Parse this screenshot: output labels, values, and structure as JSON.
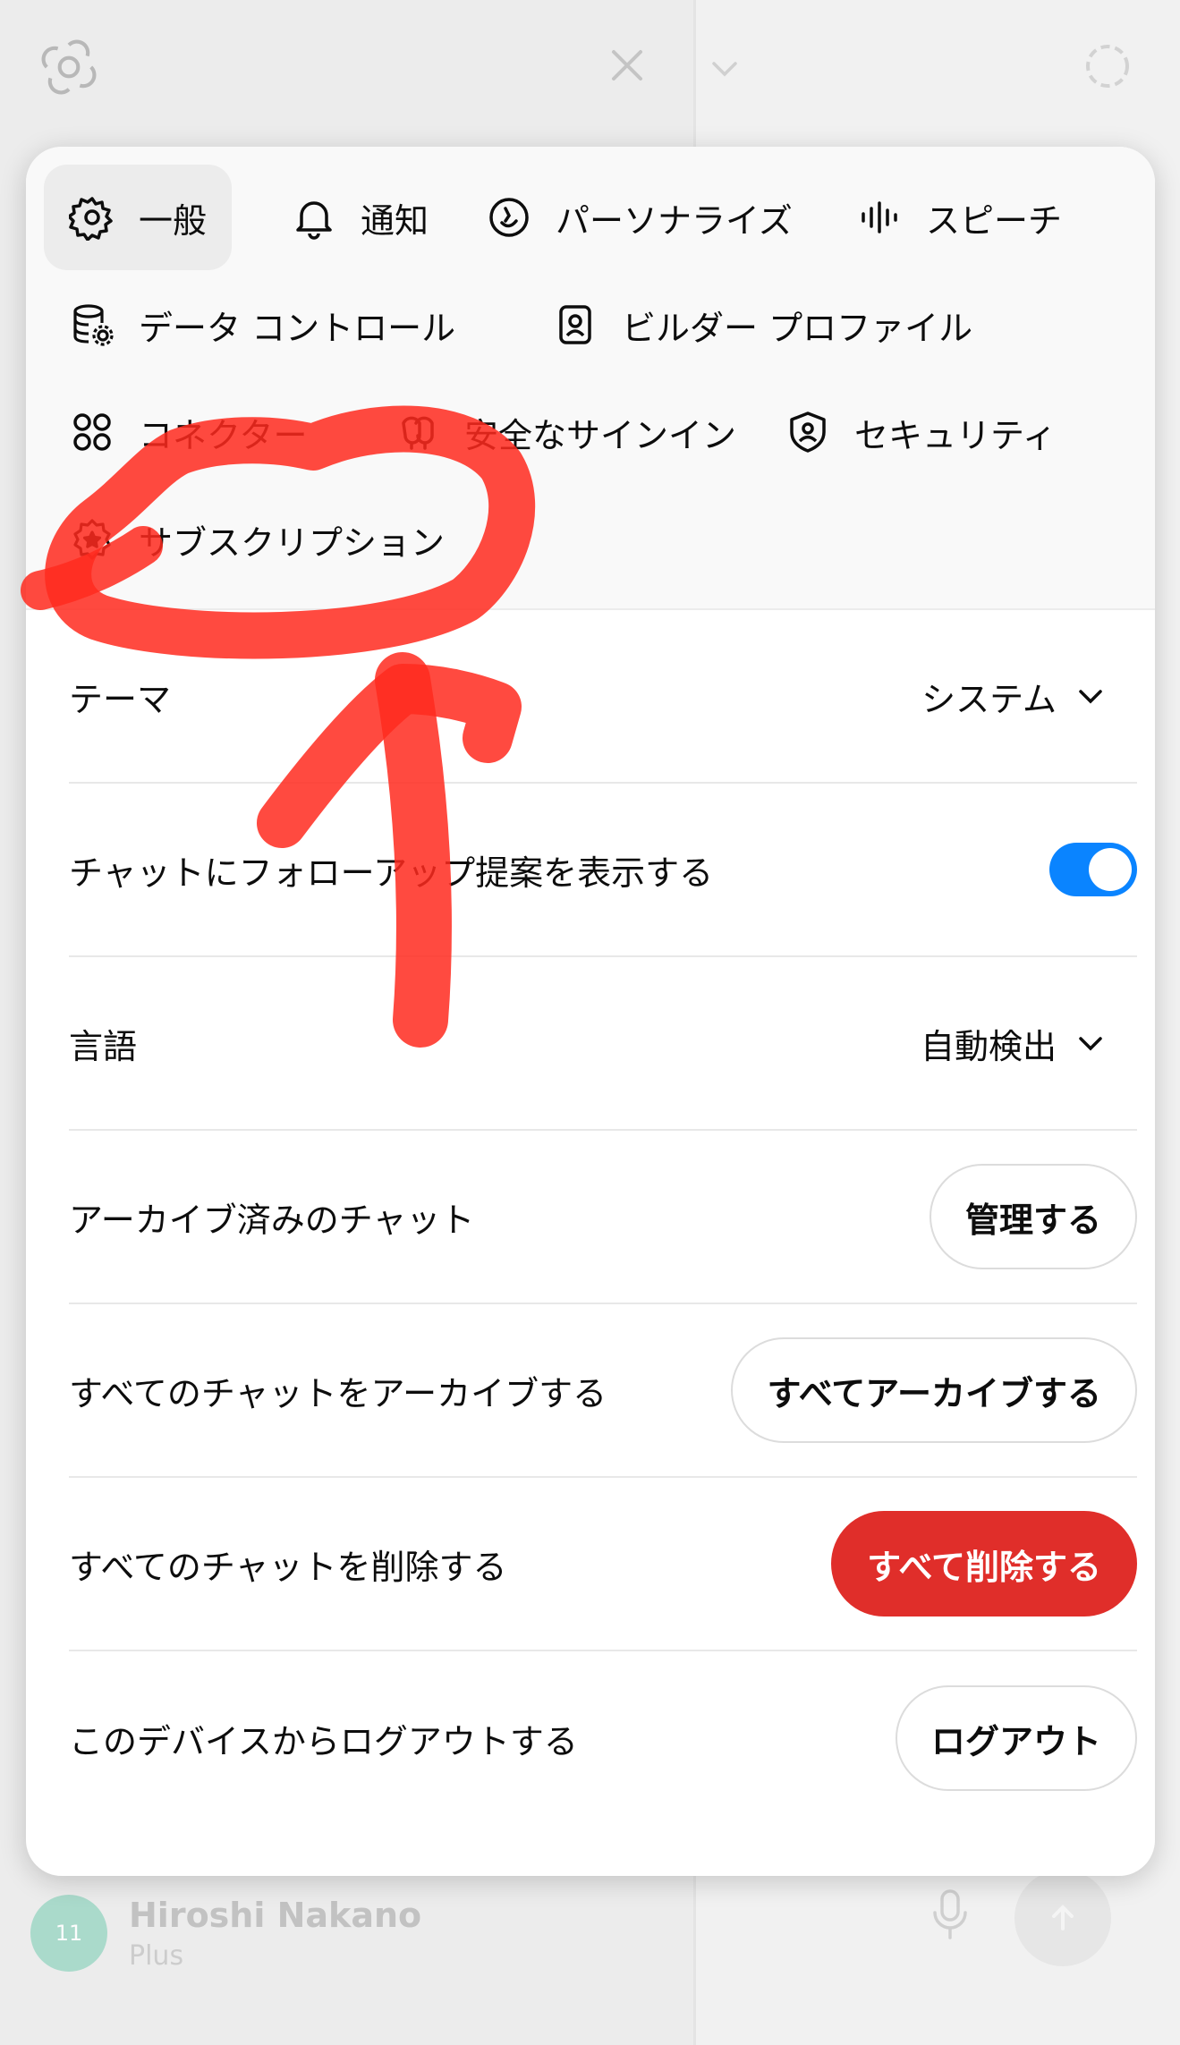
{
  "background": {
    "user_name": "Hiroshi Nakano",
    "user_plan": "Plus",
    "avatar_text": "11",
    "icons": [
      "openai-logo-icon",
      "close-icon",
      "chevron-down-icon",
      "new-chat-icon",
      "microphone-icon",
      "send-icon"
    ]
  },
  "tabs": [
    {
      "label": "一般",
      "icon": "gear-icon",
      "active": true
    },
    {
      "label": "通知",
      "icon": "bell-icon"
    },
    {
      "label": "パーソナライズ",
      "icon": "personalize-icon"
    },
    {
      "label": "スピーチ",
      "icon": "waveform-icon"
    },
    {
      "label": "データ コントロール",
      "icon": "database-gear-icon"
    },
    {
      "label": "ビルダー プロファイル",
      "icon": "id-badge-icon"
    },
    {
      "label": "コネクター",
      "icon": "connector-icon"
    },
    {
      "label": "安全なサインイン",
      "icon": "security-key-icon"
    },
    {
      "label": "セキュリティ",
      "icon": "shield-user-icon"
    },
    {
      "label": "サブスクリプション",
      "icon": "subscription-badge-icon"
    }
  ],
  "settings": {
    "theme": {
      "label": "テーマ",
      "value": "システム"
    },
    "followups": {
      "label": "チャットにフォローアップ提案を表示する",
      "enabled": true
    },
    "language": {
      "label": "言語",
      "value": "自動検出"
    },
    "archived": {
      "label": "アーカイブ済みのチャット",
      "button": "管理する"
    },
    "archive_all": {
      "label": "すべてのチャットをアーカイブする",
      "button": "すべてアーカイブする"
    },
    "delete_all": {
      "label": "すべてのチャットを削除する",
      "button": "すべて削除する"
    },
    "logout": {
      "label": "このデバイスからログアウトする",
      "button": "ログアウト"
    }
  },
  "colors": {
    "toggle_on": "#0a84ff",
    "danger": "#e02e2a",
    "annotation": "#ff2a1f"
  }
}
